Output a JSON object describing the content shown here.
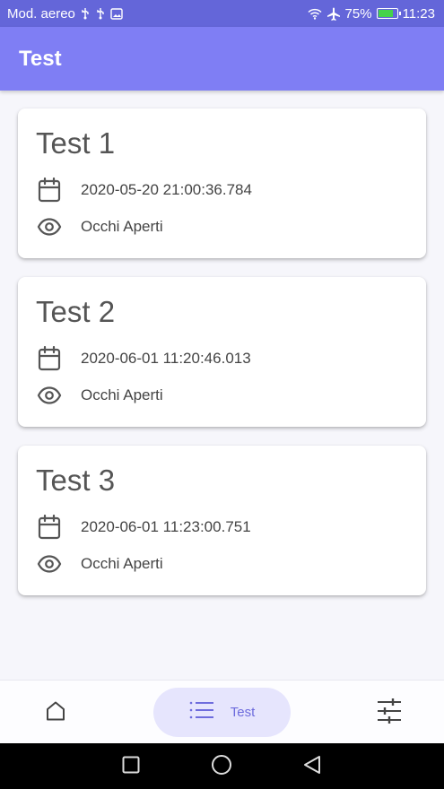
{
  "status_bar": {
    "carrier": "Mod. aereo",
    "battery": "75%",
    "time": "11:23",
    "icons": [
      "usb-icon",
      "usb-icon",
      "image-icon",
      "wifi-icon",
      "airplane-icon",
      "battery-icon"
    ]
  },
  "app_bar": {
    "title": "Test"
  },
  "tests": [
    {
      "title": "Test 1",
      "date": "2020-05-20 21:00:36.784",
      "mode": "Occhi Aperti"
    },
    {
      "title": "Test 2",
      "date": "2020-06-01 11:20:46.013",
      "mode": "Occhi Aperti"
    },
    {
      "title": "Test 3",
      "date": "2020-06-01 11:23:00.751",
      "mode": "Occhi Aperti"
    }
  ],
  "bottom_nav": {
    "items": [
      {
        "icon": "home-icon",
        "label": ""
      },
      {
        "icon": "list-icon",
        "label": "Test",
        "selected": true
      },
      {
        "icon": "sliders-icon",
        "label": ""
      }
    ]
  },
  "colors": {
    "status_bar": "#6466d9",
    "app_bar": "#7f7ef4",
    "nav_selected_bg": "#e6e5fd",
    "nav_selected_text": "#6e6cdd"
  }
}
